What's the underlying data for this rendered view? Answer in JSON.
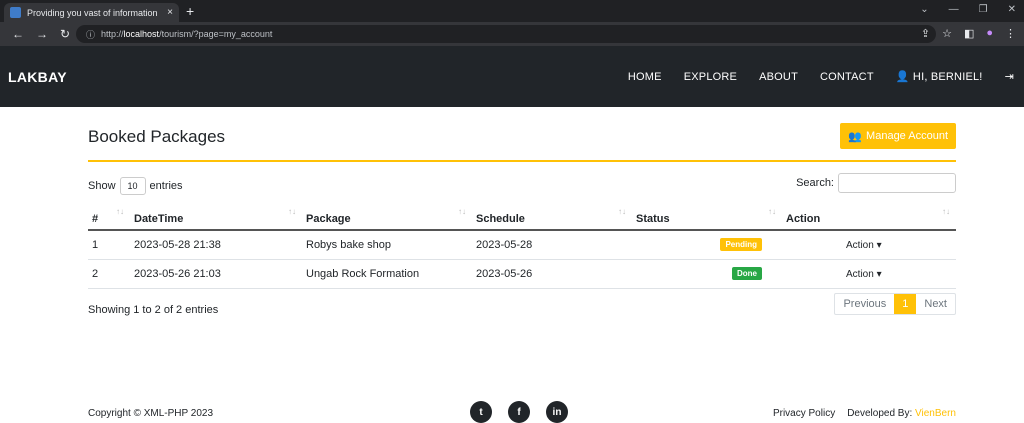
{
  "browser": {
    "tab_title": "Providing you vast of information",
    "tab_close": "×",
    "new_tab": "+",
    "url_prefix": "http://",
    "url_host": "localhost",
    "url_path": "/tourism/?page=my_account"
  },
  "nav": {
    "brand": "LAKBAY",
    "items": [
      "HOME",
      "EXPLORE",
      "ABOUT",
      "CONTACT"
    ],
    "user": "HI, BERNIEL!"
  },
  "page": {
    "title": "Booked Packages",
    "manage_label": "Manage Account",
    "show_label": "Show",
    "entries_value": "10",
    "entries_label": "entries",
    "search_label": "Search:",
    "search_value": ""
  },
  "table": {
    "headers": [
      "#",
      "DateTime",
      "Package",
      "Schedule",
      "Status",
      "Action"
    ],
    "rows": [
      {
        "num": "1",
        "datetime": "2023-05-28 21:38",
        "package": "Robys bake shop",
        "schedule": "2023-05-28",
        "status": "Pending",
        "action": "Action"
      },
      {
        "num": "2",
        "datetime": "2023-05-26 21:03",
        "package": "Ungab Rock Formation",
        "schedule": "2023-05-26",
        "status": "Done",
        "action": "Action"
      }
    ]
  },
  "pagination": {
    "info": "Showing 1 to 2 of 2 entries",
    "prev": "Previous",
    "page": "1",
    "next": "Next"
  },
  "footer": {
    "copyright": "Copyright © XML-PHP 2023",
    "privacy": "Privacy Policy",
    "developed_by": "Developed By:",
    "developer": "VienBern"
  },
  "colors": {
    "accent": "#ffc107",
    "navbar": "#212529",
    "done": "#28a745"
  }
}
